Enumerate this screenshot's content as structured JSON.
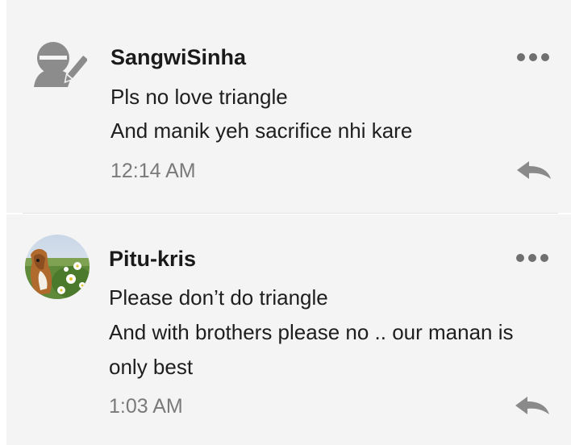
{
  "comments": [
    {
      "author": "SangwiSinha",
      "lines": [
        "Pls no love triangle",
        "And manik yeh sacrifice nhi kare"
      ],
      "time": "12:14 AM",
      "avatar_icon": "default-user-pen-icon"
    },
    {
      "author": "Pitu-kris",
      "lines": [
        "Please don’t do triangle",
        "And with brothers please no .. our manan  is",
        "only best"
      ],
      "time": "1:03 AM",
      "avatar_icon": "dog-in-daisies-photo"
    }
  ],
  "icons": {
    "more": "more-options-icon",
    "reply": "reply-icon"
  },
  "colors": {
    "card_bg": "#f4f4f4",
    "text": "#1e1e1e",
    "muted": "#7a7a7a",
    "icon": "#6f6f6f"
  }
}
